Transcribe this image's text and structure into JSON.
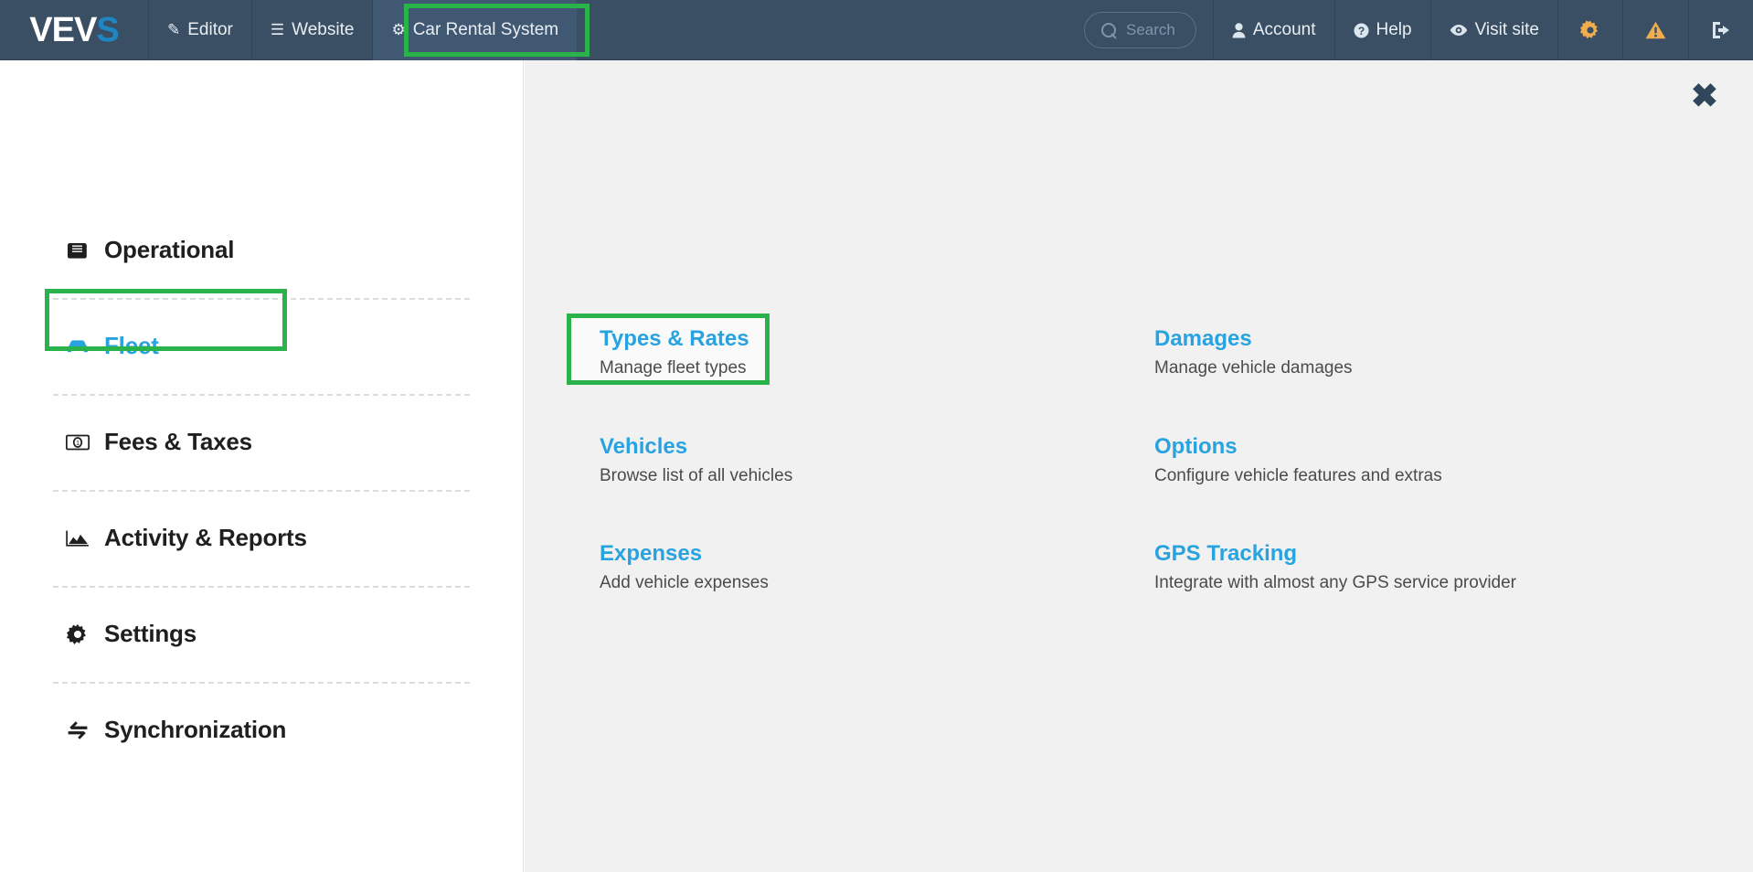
{
  "topbar": {
    "logo": {
      "text_main": "VEV",
      "text_accent": "S"
    },
    "nav_left": [
      {
        "label": "Editor",
        "icon": "pencil-icon",
        "glyph": "✎",
        "active": false
      },
      {
        "label": "Website",
        "icon": "list-icon",
        "glyph": "☰",
        "active": false
      },
      {
        "label": "Car Rental System",
        "icon": "gear-icon",
        "glyph": "⚙",
        "active": true
      }
    ],
    "search": {
      "placeholder": "Search",
      "value": "",
      "icon": "search-icon"
    },
    "nav_right": [
      {
        "label": "Account",
        "icon": "user-icon",
        "glyph": "👤"
      },
      {
        "label": "Help",
        "icon": "question-circle-icon",
        "glyph": "❓"
      },
      {
        "label": "Visit site",
        "icon": "eye-icon",
        "glyph": "👁"
      }
    ],
    "nav_right_icons": [
      {
        "name": "settings-gear-icon",
        "glyph": "⚙",
        "color": "#f0ad4e"
      },
      {
        "name": "warning-triangle-icon",
        "glyph": "⚠",
        "color": "#f0ad4e"
      },
      {
        "name": "logout-icon",
        "glyph": "↪",
        "color": "#e8eef3"
      }
    ]
  },
  "sidebar": {
    "items": [
      {
        "label": "Operational",
        "icon": "book-icon",
        "glyph": "📕",
        "active": false
      },
      {
        "label": "Fleet",
        "icon": "car-icon",
        "glyph": "🚗",
        "active": true
      },
      {
        "label": "Fees & Taxes",
        "icon": "money-icon",
        "glyph": "💵",
        "active": false
      },
      {
        "label": "Activity & Reports",
        "icon": "chart-area-icon",
        "glyph": "📈",
        "active": false
      },
      {
        "label": "Settings",
        "icon": "gear-icon",
        "glyph": "⚙",
        "active": false
      },
      {
        "label": "Synchronization",
        "icon": "refresh-icon",
        "glyph": "↻",
        "active": false
      }
    ]
  },
  "main": {
    "close_label": "✖",
    "left_column": [
      {
        "title": "Types & Rates",
        "desc": "Manage fleet types",
        "highlighted": true
      },
      {
        "title": "Vehicles",
        "desc": "Browse list of all vehicles",
        "highlighted": false
      },
      {
        "title": "Expenses",
        "desc": "Add vehicle expenses",
        "highlighted": false
      }
    ],
    "right_column": [
      {
        "title": "Damages",
        "desc": "Manage vehicle damages",
        "highlighted": false
      },
      {
        "title": "Options",
        "desc": "Configure vehicle features and extras",
        "highlighted": false
      },
      {
        "title": "GPS Tracking",
        "desc": "Integrate with almost any GPS service provider",
        "highlighted": false
      }
    ]
  },
  "colors": {
    "topbar_bg": "#3a4f63",
    "topbar_active": "#415872",
    "accent_link": "#29a3e0",
    "annotation_green": "#2bb34b",
    "main_bg": "#f1f1f1",
    "sidebar_bg": "#ffffff"
  }
}
